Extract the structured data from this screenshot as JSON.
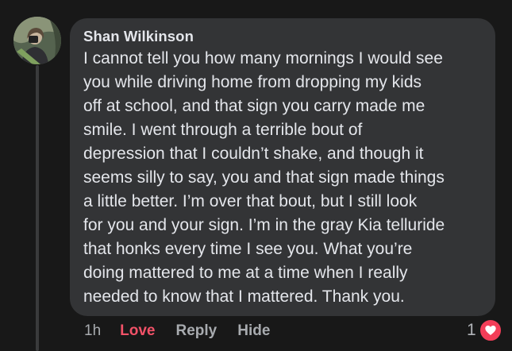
{
  "comment": {
    "author": "Shan Wilkinson",
    "text": "I cannot tell you how many mornings I would see\nyou while driving home from dropping my kids\noff at school, and that sign you carry made me\nsmile. I went through a terrible bout of\ndepression that I couldn’t shake, and though it\nseems silly to say, you and that sign made things\na little better. I’m over that bout, but I still look\nfor you and your sign. I’m in the gray Kia telluride\nthat honks every time I see you. What you’re\ndoing mattered to me at a time when I really\nneeded to know that I mattered. Thank you."
  },
  "actions": {
    "timestamp": "1h",
    "love_label": "Love",
    "reply_label": "Reply",
    "hide_label": "Hide"
  },
  "reactions": {
    "count": "1",
    "icon": "heart-icon"
  },
  "colors": {
    "background": "#181818",
    "bubble": "#333436",
    "love": "#f25268",
    "heart_badge": "#f33e58",
    "muted_text": "#a8abaf"
  }
}
